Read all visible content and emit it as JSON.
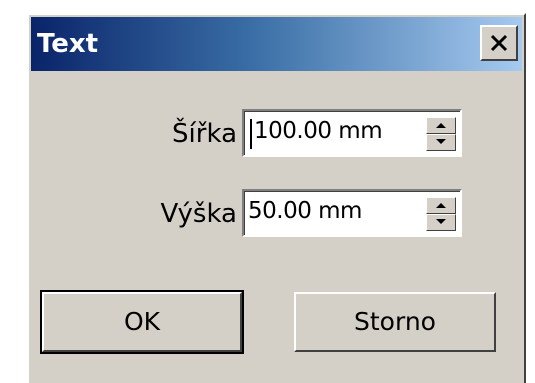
{
  "window": {
    "title": "Text"
  },
  "fields": {
    "width": {
      "label": "Šířka",
      "value": "100.00 mm"
    },
    "height": {
      "label": "Výška",
      "value": "50.00 mm"
    }
  },
  "buttons": {
    "ok_label": "OK",
    "cancel_label": "Storno"
  },
  "icons": {
    "close": "close-icon",
    "spin_up": "arrow-up-icon",
    "spin_down": "arrow-down-icon"
  },
  "colors": {
    "face": "#d4d0c8",
    "title_start": "#0a246a",
    "title_end": "#a6caf0"
  }
}
